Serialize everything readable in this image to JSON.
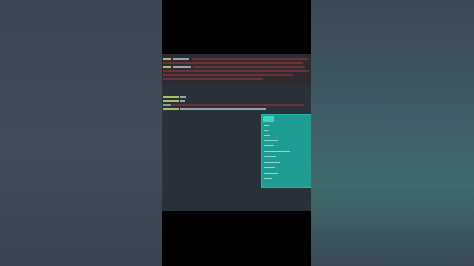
{
  "terminal": {
    "lines": [
      {
        "prompt": "> $ ",
        "text": ""
      },
      {
        "prompt": "> $ ",
        "text": ""
      },
      {
        "prompt": "> $ ",
        "text": ""
      },
      {
        "prompt": "> $ ",
        "text": ""
      },
      {
        "prompt": "> $ ",
        "text": ""
      }
    ]
  },
  "dropdown": {
    "items": [
      "",
      "",
      "",
      "",
      "",
      "",
      "",
      "",
      "",
      ""
    ]
  },
  "colors": {
    "background": "#2a3039",
    "error": "#b8474e",
    "prompt": "#c9d88a",
    "dropdown": "#1f9c92",
    "dropdown_selected": "#44d3c2"
  }
}
